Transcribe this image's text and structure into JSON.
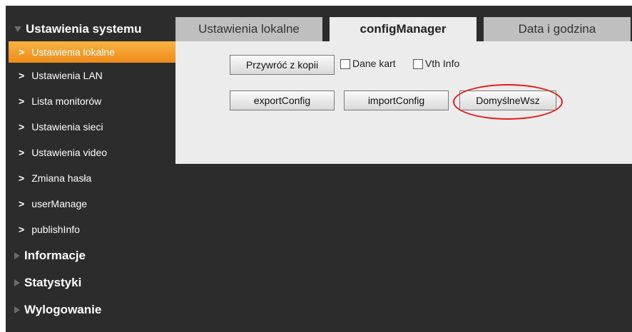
{
  "sidebar": {
    "system_header": "Ustawienia systemu",
    "items": [
      {
        "label": "Ustawienia lokalne",
        "active": true
      },
      {
        "label": "Ustawienia LAN"
      },
      {
        "label": "Lista monitorów"
      },
      {
        "label": "Ustawienia sieci"
      },
      {
        "label": "Ustawienia video"
      },
      {
        "label": "Zmiana hasła"
      },
      {
        "label": "userManage"
      },
      {
        "label": "publishInfo"
      }
    ],
    "sections": [
      {
        "label": "Informacje"
      },
      {
        "label": "Statystyki"
      },
      {
        "label": "Wylogowanie"
      }
    ]
  },
  "tabs": [
    {
      "label": "Ustawienia lokalne"
    },
    {
      "label": "configManager",
      "active": true
    },
    {
      "label": "Data i godzina"
    }
  ],
  "panel": {
    "restore_button": "Przywróć z kopii",
    "checkbox_card_data": "Dane kart",
    "checkbox_vth_info": "Vth Info",
    "export_button": "exportConfig",
    "import_button": "importConfig",
    "default_button": "DomyślneWsz"
  },
  "colors": {
    "accent_orange": "#f0921e",
    "sidebar_bg": "#2c2c2c",
    "panel_bg": "#ececec",
    "highlight_red": "#e21d1d"
  }
}
